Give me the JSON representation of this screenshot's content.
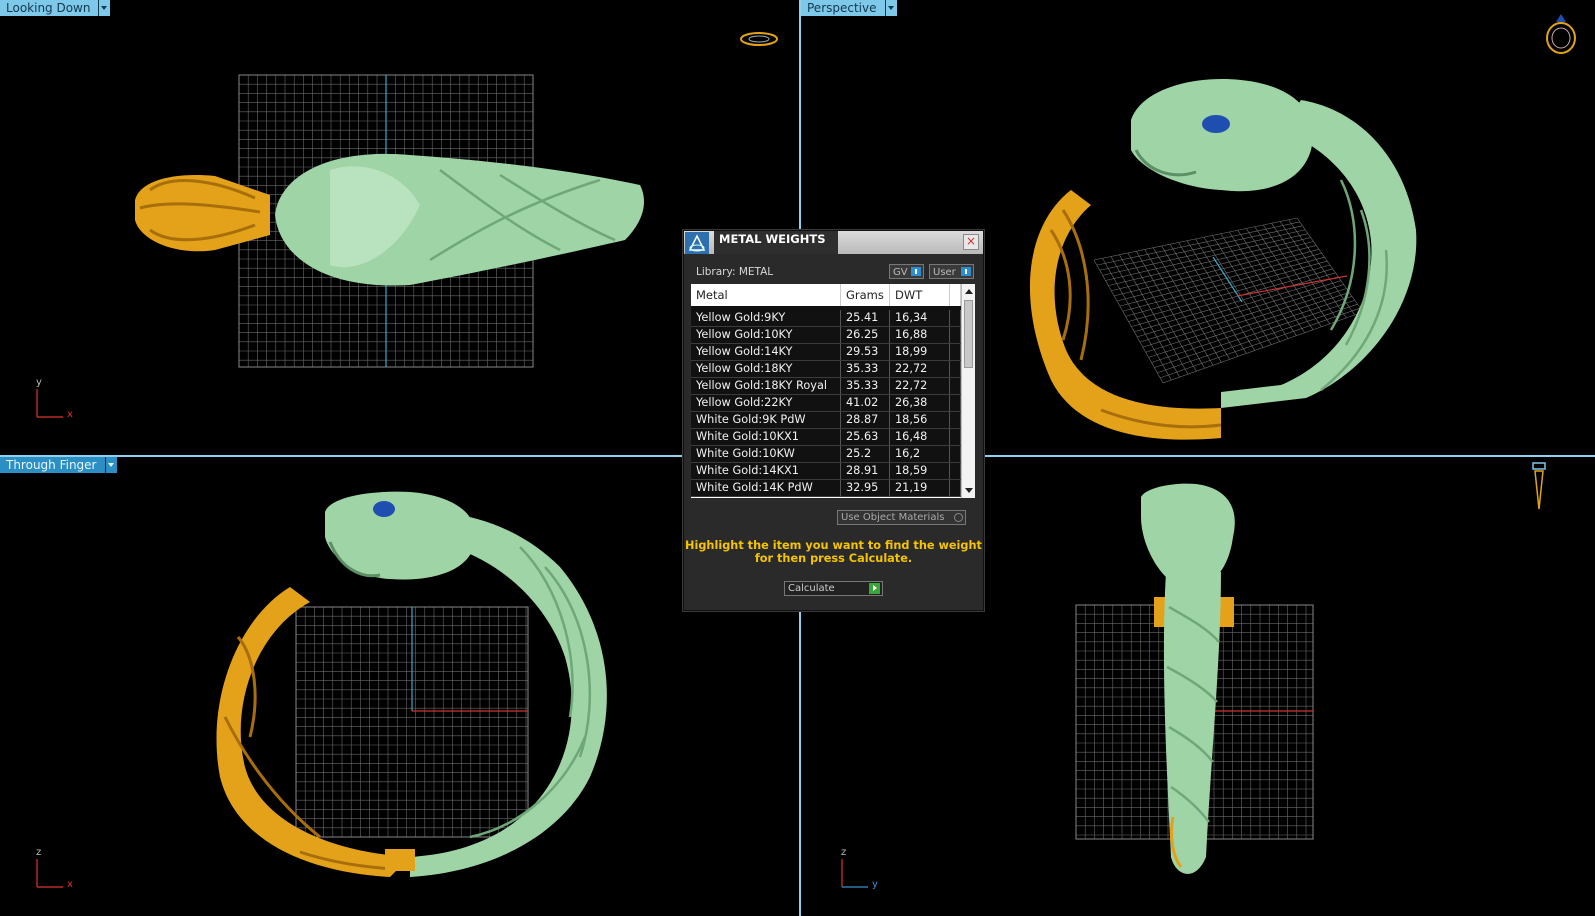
{
  "viewports": {
    "top_left": {
      "label": "Looking Down",
      "axis_v": "y",
      "axis_h": "x"
    },
    "top_right": {
      "label": "Perspective"
    },
    "bottom_left": {
      "label": "Through Finger",
      "axis_v": "z",
      "axis_h": "x"
    },
    "bottom_right": {
      "label": "",
      "axis_v": "z",
      "axis_h": "y"
    }
  },
  "colors": {
    "accent": "#7ec8ea",
    "metal_yellow": "#e3a21a",
    "metal_green": "#9fd4a6",
    "gem_blue": "#1e4fb0",
    "hint_text": "#f5c400"
  },
  "icons": [
    "ring-top-icon",
    "ring-perspective-icon",
    "ring-side-icon",
    "dialog-logo-icon",
    "close-icon",
    "scroll-up-icon",
    "scroll-down-icon",
    "calculate-go-icon"
  ],
  "dialog": {
    "title": "METAL WEIGHTS",
    "library_label": "Library: METAL",
    "gv_label": "GV",
    "user_label": "User",
    "columns": [
      "Metal",
      "Grams",
      "DWT"
    ],
    "rows": [
      {
        "metal": "Yellow Gold:9KY",
        "grams": "25.41",
        "dwt": "16,34"
      },
      {
        "metal": "Yellow Gold:10KY",
        "grams": "26.25",
        "dwt": "16,88"
      },
      {
        "metal": "Yellow Gold:14KY",
        "grams": "29.53",
        "dwt": "18,99"
      },
      {
        "metal": "Yellow Gold:18KY",
        "grams": "35.33",
        "dwt": "22,72"
      },
      {
        "metal": "Yellow Gold:18KY Royal",
        "grams": "35.33",
        "dwt": "22,72"
      },
      {
        "metal": "Yellow Gold:22KY",
        "grams": "41.02",
        "dwt": "26,38"
      },
      {
        "metal": "White Gold:9K PdW",
        "grams": "28.87",
        "dwt": "18,56"
      },
      {
        "metal": "White Gold:10KX1",
        "grams": "25.63",
        "dwt": "16,48"
      },
      {
        "metal": "White Gold:10KW",
        "grams": "25.2",
        "dwt": "16,2"
      },
      {
        "metal": "White Gold:14KX1",
        "grams": "28.91",
        "dwt": "18,59"
      },
      {
        "metal": "White Gold:14K PdW",
        "grams": "32.95",
        "dwt": "21,19"
      }
    ],
    "use_object_materials": "Use Object Materials",
    "hint": "Highlight the item you want to find the weight for then press Calculate.",
    "calculate_label": "Calculate"
  }
}
